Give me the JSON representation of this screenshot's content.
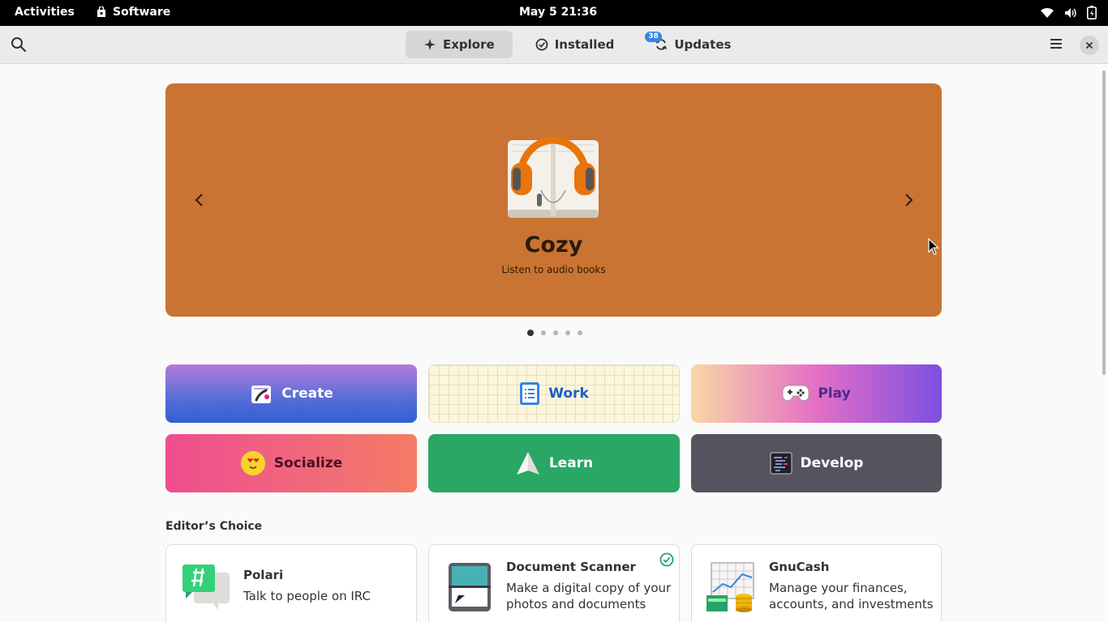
{
  "system_bar": {
    "activities": "Activities",
    "app_name": "Software",
    "clock": "May 5  21:36"
  },
  "header": {
    "tabs": [
      {
        "label": "Explore",
        "active": true
      },
      {
        "label": "Installed",
        "active": false
      },
      {
        "label": "Updates",
        "active": false,
        "badge": "38"
      }
    ]
  },
  "banner": {
    "app_name": "Cozy",
    "app_description": "Listen to audio books",
    "page_count": 5,
    "current_page": 1
  },
  "categories": [
    {
      "label": "Create"
    },
    {
      "label": "Work"
    },
    {
      "label": "Play"
    },
    {
      "label": "Socialize"
    },
    {
      "label": "Learn"
    },
    {
      "label": "Develop"
    }
  ],
  "editors_choice": {
    "title": "Editor’s Choice",
    "apps": [
      {
        "name": "Polari",
        "description": "Talk to people on IRC",
        "installed": false
      },
      {
        "name": "Document Scanner",
        "description": "Make a digital copy of your photos and documents",
        "installed": true
      },
      {
        "name": "GnuCash",
        "description": "Manage your finances, accounts, and investments",
        "installed": false
      }
    ]
  },
  "colors": {
    "banner_bg": "#c97432",
    "accent": "#3584e4",
    "installed_check": "#26a269"
  }
}
